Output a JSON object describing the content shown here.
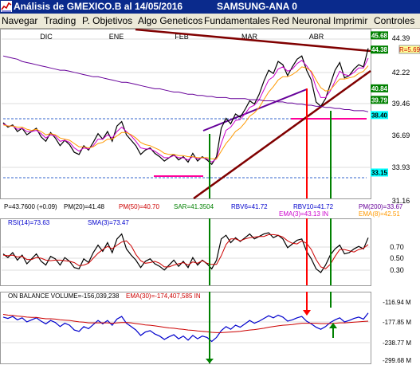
{
  "window": {
    "title": "Análisis de GMEXICO.B al 14/05/2016",
    "subtitle": "SAMSUNG-ANA 0"
  },
  "menu": [
    "Navegar",
    "Trading",
    "P. Objetivos",
    "Algo Geneticos",
    "Fundamentales",
    "Red Neuronal",
    "Imprimir",
    "Controles"
  ],
  "colors": {
    "background": "#ffffff",
    "price": "#000000",
    "ema3": "#cc00cc",
    "ema8": "#ff9900",
    "pm200": "#660099",
    "trendline": "#800000",
    "support": "#ff0099",
    "cyan_level": "#00ffff",
    "green_arrow": "#008000",
    "red_arrow": "#ff0000",
    "obv": "#0000cc",
    "obv_ema": "#cc0000",
    "rsi": "#000000",
    "rsi_sma": "#cc0000"
  },
  "chart_data": [
    {
      "type": "line",
      "panel": "price",
      "x_labels": [
        "DIC",
        "ENE",
        "FEB",
        "MAR",
        "ABR"
      ],
      "y_ticks": [
        "44.39",
        "42.22",
        "39.46",
        "36.69",
        "33.93",
        "31.16"
      ],
      "price_tags": [
        {
          "label": "45.68",
          "value": 45.68,
          "color": "#008000",
          "text": "#ffffff"
        },
        {
          "label": "44.38",
          "value": 44.38,
          "color": "#008000",
          "text": "#ffffff"
        },
        {
          "label": "40.84",
          "value": 40.84,
          "color": "#008000",
          "text": "#ffffff"
        },
        {
          "label": "39.79",
          "value": 39.79,
          "color": "#008000",
          "text": "#ffffff"
        },
        {
          "label": "38.40",
          "value": 38.4,
          "color": "#00ffff",
          "text": "#000000"
        },
        {
          "label": "33.15",
          "value": 33.15,
          "color": "#00ffff",
          "text": "#000000"
        }
      ],
      "r_label": "R=5.69",
      "stats": {
        "p": "P=43.7600 (+0.09)",
        "pm20": "PM(20)=41.48",
        "pm50": "PM(50)=40.70",
        "sar": "SAR=41.3504",
        "rbv6": "RBV6=41.72",
        "rbv10": "RBV10=41.72",
        "pm200": "PM(200)=33.67",
        "ema3": "EMA(3)=43.13 IN",
        "ema8": "EMA(8)=42.51"
      },
      "ylim": [
        31.0,
        46.0
      ],
      "series": [
        {
          "color": "#000000",
          "values": [
            37.7,
            37.3,
            37.5,
            36.9,
            37.2,
            36.6,
            36.9,
            37.2,
            36.4,
            36.0,
            36.8,
            36.3,
            35.6,
            36.1,
            35.7,
            35.0,
            34.8,
            35.6,
            35.2,
            35.9,
            36.7,
            36.2,
            36.9,
            36.0,
            37.4,
            37.8,
            36.6,
            36.1,
            35.6,
            34.8,
            35.2,
            35.4,
            34.9,
            34.6,
            34.2,
            34.5,
            34.8,
            34.3,
            34.6,
            34.1,
            34.9,
            34.2,
            34.6,
            34.3,
            33.9,
            34.6,
            37.2,
            38.1,
            37.6,
            38.5,
            38.2,
            38.9,
            39.7,
            39.4,
            40.3,
            41.5,
            42.5,
            42.2,
            43.3,
            43.0,
            42.0,
            42.8,
            43.5,
            43.8,
            42.5,
            41.6,
            39.6,
            39.2,
            39.9,
            41.2,
            42.5,
            43.2,
            41.8,
            42.0,
            42.6,
            43.0,
            42.8,
            44.5
          ]
        },
        {
          "color": "#cc00cc",
          "values": [
            37.6,
            37.4,
            37.4,
            37.1,
            37.2,
            36.9,
            36.9,
            37.0,
            36.7,
            36.3,
            36.6,
            36.5,
            36.0,
            36.1,
            35.9,
            35.4,
            35.1,
            35.4,
            35.3,
            35.6,
            36.2,
            36.2,
            36.6,
            36.3,
            36.9,
            37.3,
            36.9,
            36.5,
            36.0,
            35.4,
            35.3,
            35.3,
            35.1,
            34.8,
            34.5,
            34.5,
            34.7,
            34.5,
            34.5,
            34.3,
            34.6,
            34.4,
            34.5,
            34.4,
            34.1,
            34.4,
            35.8,
            37.0,
            37.3,
            37.9,
            38.0,
            38.5,
            39.1,
            39.3,
            39.8,
            40.7,
            41.6,
            41.9,
            42.6,
            42.8,
            42.4,
            42.6,
            43.1,
            43.4,
            42.9,
            42.3,
            40.9,
            40.0,
            40.0,
            40.6,
            41.5,
            42.4,
            42.1,
            42.0,
            42.3,
            42.7,
            42.7,
            43.6
          ]
        },
        {
          "color": "#ff9900",
          "values": [
            37.5,
            37.4,
            37.4,
            37.3,
            37.3,
            37.1,
            37.0,
            37.1,
            36.9,
            36.6,
            36.7,
            36.6,
            36.3,
            36.2,
            36.1,
            35.8,
            35.5,
            35.5,
            35.4,
            35.5,
            35.8,
            35.9,
            36.2,
            36.2,
            36.5,
            36.8,
            36.8,
            36.6,
            36.3,
            35.9,
            35.7,
            35.6,
            35.4,
            35.2,
            34.9,
            34.8,
            34.8,
            34.7,
            34.7,
            34.6,
            34.6,
            34.5,
            34.5,
            34.5,
            34.4,
            34.4,
            35.1,
            35.8,
            36.3,
            36.9,
            37.2,
            37.7,
            38.3,
            38.6,
            39.1,
            39.8,
            40.5,
            41.0,
            41.6,
            41.9,
            41.9,
            42.1,
            42.4,
            42.8,
            42.7,
            42.4,
            41.6,
            40.9,
            40.6,
            40.7,
            41.2,
            41.7,
            41.7,
            41.8,
            41.9,
            42.2,
            42.4,
            42.9
          ]
        },
        {
          "color": "#660099",
          "values": [
            43.8,
            43.7,
            43.6,
            43.5,
            43.3,
            43.2,
            43.1,
            43.0,
            42.9,
            42.8,
            42.7,
            42.6,
            42.5,
            42.5,
            42.4,
            42.3,
            42.2,
            42.1,
            42.0,
            41.9,
            41.9,
            41.8,
            41.7,
            41.6,
            41.5,
            41.4,
            41.4,
            41.3,
            41.2,
            41.1,
            41.0,
            40.9,
            40.8,
            40.8,
            40.7,
            40.6,
            40.5,
            40.5,
            40.4,
            40.3,
            40.3,
            40.2,
            40.2,
            40.1,
            40.1,
            40.0,
            40.0,
            40.0,
            39.9,
            39.9,
            39.9,
            39.9,
            39.8,
            39.8,
            39.8,
            39.7,
            39.7,
            39.7,
            39.6,
            39.6,
            39.5,
            39.5,
            39.4,
            39.4,
            39.3,
            39.3,
            39.2,
            39.2,
            39.1,
            39.1,
            39.0,
            39.0,
            38.9,
            38.9,
            38.8,
            38.8,
            38.8,
            38.7
          ]
        }
      ]
    },
    {
      "type": "line",
      "panel": "rsi",
      "labels": {
        "rsi": "RSI(14)=73.63",
        "sma": "SMA(3)=73.47"
      },
      "y_ticks": [
        "0.70",
        "0.50",
        "0.30"
      ],
      "ylim": [
        0,
        1
      ],
      "series": [
        {
          "color": "#000000",
          "values": [
            0.48,
            0.42,
            0.5,
            0.38,
            0.46,
            0.32,
            0.4,
            0.48,
            0.36,
            0.3,
            0.44,
            0.4,
            0.3,
            0.42,
            0.36,
            0.26,
            0.24,
            0.4,
            0.34,
            0.5,
            0.62,
            0.52,
            0.66,
            0.5,
            0.72,
            0.8,
            0.56,
            0.46,
            0.38,
            0.26,
            0.36,
            0.4,
            0.32,
            0.28,
            0.22,
            0.3,
            0.38,
            0.28,
            0.36,
            0.26,
            0.42,
            0.3,
            0.38,
            0.32,
            0.24,
            0.38,
            0.72,
            0.78,
            0.66,
            0.74,
            0.68,
            0.74,
            0.8,
            0.72,
            0.76,
            0.8,
            0.82,
            0.74,
            0.78,
            0.72,
            0.58,
            0.64,
            0.7,
            0.72,
            0.52,
            0.4,
            0.24,
            0.18,
            0.3,
            0.46,
            0.56,
            0.62,
            0.48,
            0.5,
            0.56,
            0.6,
            0.56,
            0.74
          ]
        },
        {
          "color": "#cc0000",
          "values": [
            0.46,
            0.45,
            0.46,
            0.43,
            0.44,
            0.39,
            0.39,
            0.42,
            0.41,
            0.38,
            0.37,
            0.38,
            0.38,
            0.37,
            0.36,
            0.34,
            0.29,
            0.3,
            0.33,
            0.41,
            0.49,
            0.55,
            0.6,
            0.56,
            0.62,
            0.67,
            0.69,
            0.61,
            0.47,
            0.37,
            0.33,
            0.34,
            0.36,
            0.33,
            0.27,
            0.27,
            0.3,
            0.32,
            0.34,
            0.3,
            0.35,
            0.33,
            0.37,
            0.33,
            0.31,
            0.31,
            0.45,
            0.63,
            0.72,
            0.72,
            0.69,
            0.72,
            0.74,
            0.75,
            0.76,
            0.76,
            0.79,
            0.79,
            0.78,
            0.75,
            0.69,
            0.65,
            0.64,
            0.69,
            0.65,
            0.55,
            0.39,
            0.27,
            0.24,
            0.31,
            0.44,
            0.55,
            0.55,
            0.53,
            0.51,
            0.55,
            0.57,
            0.63
          ]
        }
      ]
    },
    {
      "type": "line",
      "panel": "obv",
      "labels": {
        "obv": "ON BALANCE VOLUME=-156,039,238",
        "ema": "EMA(30)=-174,407,585 IN"
      },
      "y_ticks": [
        "-116.94 M",
        "-177.85 M",
        "-238.77 M",
        "-299.68 M"
      ],
      "ylim": [
        -300,
        -100
      ],
      "series": [
        {
          "color": "#0000cc",
          "values": [
            -168,
            -172,
            -166,
            -176,
            -170,
            -182,
            -176,
            -170,
            -180,
            -188,
            -178,
            -184,
            -196,
            -186,
            -192,
            -206,
            -210,
            -196,
            -202,
            -190,
            -178,
            -188,
            -178,
            -192,
            -174,
            -166,
            -186,
            -196,
            -206,
            -222,
            -212,
            -208,
            -218,
            -224,
            -234,
            -226,
            -220,
            -232,
            -224,
            -236,
            -222,
            -232,
            -224,
            -228,
            -240,
            -228,
            -208,
            -196,
            -204,
            -192,
            -198,
            -188,
            -178,
            -186,
            -180,
            -172,
            -164,
            -170,
            -162,
            -168,
            -180,
            -176,
            -170,
            -166,
            -180,
            -188,
            -198,
            -204,
            -196,
            -184,
            -176,
            -170,
            -182,
            -178,
            -172,
            -168,
            -174,
            -156
          ]
        },
        {
          "color": "#cc0000",
          "values": [
            -160,
            -162,
            -163,
            -165,
            -166,
            -168,
            -169,
            -169,
            -171,
            -173,
            -173,
            -174,
            -176,
            -177,
            -178,
            -180,
            -182,
            -183,
            -185,
            -185,
            -185,
            -185,
            -185,
            -186,
            -185,
            -184,
            -184,
            -185,
            -187,
            -189,
            -191,
            -192,
            -194,
            -196,
            -198,
            -200,
            -201,
            -203,
            -204,
            -206,
            -207,
            -209,
            -210,
            -211,
            -213,
            -214,
            -214,
            -213,
            -212,
            -211,
            -210,
            -208,
            -206,
            -205,
            -203,
            -201,
            -198,
            -196,
            -194,
            -192,
            -191,
            -190,
            -188,
            -186,
            -186,
            -186,
            -186,
            -187,
            -187,
            -187,
            -186,
            -185,
            -185,
            -184,
            -183,
            -182,
            -181,
            -180
          ]
        }
      ]
    }
  ]
}
